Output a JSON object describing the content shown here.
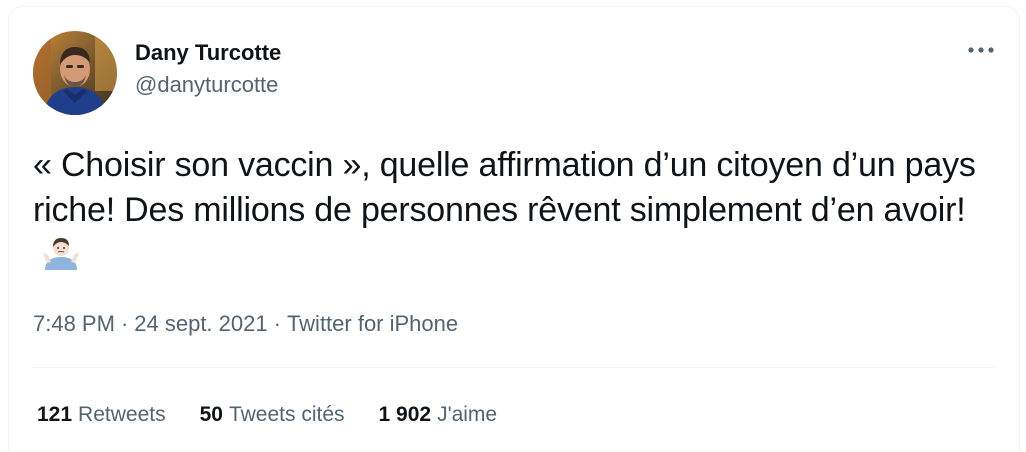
{
  "author": {
    "display_name": "Dany Turcotte",
    "handle": "@danyturcotte"
  },
  "tweet": {
    "text": "« Choisir son vaccin », quelle affirmation d’un citoyen d’un pays riche! Des millions de personnes rêvent simplement d’en avoir!",
    "emoji": "person-shrugging-emoji"
  },
  "meta": {
    "time": "7:48 PM",
    "date": "24 sept. 2021",
    "source": "Twitter for iPhone",
    "separator": "·"
  },
  "stats": {
    "retweets_count": "121",
    "retweets_label": "Retweets",
    "quotes_count": "50",
    "quotes_label": "Tweets cités",
    "likes_count": "1 902",
    "likes_label": "J'aime"
  },
  "icons": {
    "more": "more-horizontal-icon"
  },
  "colors": {
    "text_primary": "#0f1419",
    "text_secondary": "#536471",
    "border": "#eff3f4"
  }
}
